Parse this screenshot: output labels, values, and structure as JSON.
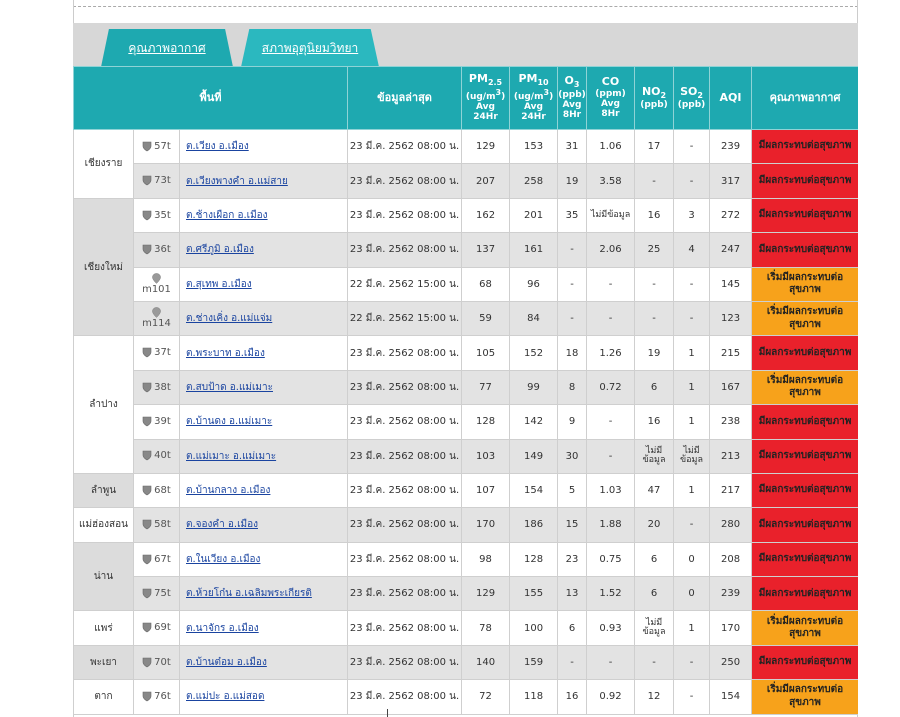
{
  "tabs": [
    {
      "label": "คุณภาพอากาศ",
      "active": true
    },
    {
      "label": "สภาพอุตุนิยมวิทยา",
      "active": false
    }
  ],
  "headers": {
    "area": "พื้นที่",
    "latest": "ข้อมูลล่าสุด",
    "pm25_main": "PM",
    "pm25_sub": "2.5",
    "pm25_unit": "(ug/m",
    "pm25_unit_sup": "3",
    "pm25_unit_end": ")",
    "pm25_avg": "Avg",
    "pm25_period": "24Hr",
    "pm10_main": "PM",
    "pm10_sub": "10",
    "pm10_unit": "(ug/m",
    "pm10_unit_sup": "3",
    "pm10_unit_end": ")",
    "pm10_avg": "Avg",
    "pm10_period": "24Hr",
    "o3_main": "O",
    "o3_sub": "3",
    "o3_unit": "(ppb)",
    "o3_avg": "Avg",
    "o3_period": "8Hr",
    "co_main": "CO",
    "co_unit": "(ppm)",
    "co_avg": "Avg",
    "co_period": "8Hr",
    "no2_main": "NO",
    "no2_sub": "2",
    "no2_unit": "(ppb)",
    "so2_main": "SO",
    "so2_sub": "2",
    "so2_unit": "(ppb)",
    "aqi": "AQI",
    "quality": "คุณภาพอากาศ"
  },
  "colors": {
    "header": "#1ea9b0",
    "red": "#e9212b",
    "orange": "#f7a21b",
    "link": "#1a44a0"
  },
  "status_text": {
    "red": "มีผลกระทบต่อสุขภาพ",
    "orange": "เริ่มมีผลกระทบต่อสุขภาพ"
  },
  "provinces": [
    {
      "name": "เชียงราย",
      "rowspan": 2,
      "shade": "white"
    },
    {
      "name": "เชียงใหม่",
      "rowspan": 4,
      "shade": "gray"
    },
    {
      "name": "ลำปาง",
      "rowspan": 4,
      "shade": "white"
    },
    {
      "name": "ลำพูน",
      "rowspan": 1,
      "shade": "gray"
    },
    {
      "name": "แม่ฮ่องสอน",
      "rowspan": 1,
      "shade": "white"
    },
    {
      "name": "น่าน",
      "rowspan": 2,
      "shade": "gray"
    },
    {
      "name": "แพร่",
      "rowspan": 1,
      "shade": "white"
    },
    {
      "name": "พะเยา",
      "rowspan": 1,
      "shade": "gray"
    },
    {
      "name": "ตาก",
      "rowspan": 1,
      "shade": "white"
    }
  ],
  "rows": [
    {
      "icon": "shield",
      "code": "57t",
      "site": "ต.เวียง อ.เมือง",
      "date": "23 มี.ค. 2562 08:00 น.",
      "pm25": "129",
      "pm10": "153",
      "o3": "31",
      "co": "1.06",
      "no2": "17",
      "so2": "-",
      "aqi": "239",
      "level": "red"
    },
    {
      "icon": "shield",
      "code": "73t",
      "site": "ต.เวียงพางคำ อ.แม่สาย",
      "date": "23 มี.ค. 2562 08:00 น.",
      "pm25": "207",
      "pm10": "258",
      "o3": "19",
      "co": "3.58",
      "no2": "-",
      "so2": "-",
      "aqi": "317",
      "level": "red"
    },
    {
      "icon": "shield",
      "code": "35t",
      "site": "ต.ช้างเผือก อ.เมือง",
      "date": "23 มี.ค. 2562 08:00 น.",
      "pm25": "162",
      "pm10": "201",
      "o3": "35",
      "co": "ไม่มีข้อมูล",
      "no2": "16",
      "so2": "3",
      "aqi": "272",
      "level": "red"
    },
    {
      "icon": "shield",
      "code": "36t",
      "site": "ต.ศรีภูมิ อ.เมือง",
      "date": "23 มี.ค. 2562 08:00 น.",
      "pm25": "137",
      "pm10": "161",
      "o3": "-",
      "co": "2.06",
      "no2": "25",
      "so2": "4",
      "aqi": "247",
      "level": "red"
    },
    {
      "icon": "pin",
      "code": "m101",
      "site": "ต.สุเทพ อ.เมือง",
      "date": "22 มี.ค. 2562 15:00 น.",
      "pm25": "68",
      "pm10": "96",
      "o3": "-",
      "co": "-",
      "no2": "-",
      "so2": "-",
      "aqi": "145",
      "level": "orange"
    },
    {
      "icon": "pin",
      "code": "m114",
      "site": "ต.ช่างเคิ่ง อ.แม่แจ่ม",
      "date": "22 มี.ค. 2562 15:00 น.",
      "pm25": "59",
      "pm10": "84",
      "o3": "-",
      "co": "-",
      "no2": "-",
      "so2": "-",
      "aqi": "123",
      "level": "orange"
    },
    {
      "icon": "shield",
      "code": "37t",
      "site": "ต.พระบาท อ.เมือง",
      "date": "23 มี.ค. 2562 08:00 น.",
      "pm25": "105",
      "pm10": "152",
      "o3": "18",
      "co": "1.26",
      "no2": "19",
      "so2": "1",
      "aqi": "215",
      "level": "red"
    },
    {
      "icon": "shield",
      "code": "38t",
      "site": "ต.สบป้าด อ.แม่เมาะ",
      "date": "23 มี.ค. 2562 08:00 น.",
      "pm25": "77",
      "pm10": "99",
      "o3": "8",
      "co": "0.72",
      "no2": "6",
      "so2": "1",
      "aqi": "167",
      "level": "orange"
    },
    {
      "icon": "shield",
      "code": "39t",
      "site": "ต.บ้านดง อ.แม่เมาะ",
      "date": "23 มี.ค. 2562 08:00 น.",
      "pm25": "128",
      "pm10": "142",
      "o3": "9",
      "co": "-",
      "no2": "16",
      "so2": "1",
      "aqi": "238",
      "level": "red"
    },
    {
      "icon": "shield",
      "code": "40t",
      "site": "ต.แม่เมาะ อ.แม่เมาะ",
      "date": "23 มี.ค. 2562 08:00 น.",
      "pm25": "103",
      "pm10": "149",
      "o3": "30",
      "co": "-",
      "no2": "ไม่มีข้อมูล",
      "so2": "ไม่มีข้อมูล",
      "aqi": "213",
      "level": "red"
    },
    {
      "icon": "shield",
      "code": "68t",
      "site": "ต.บ้านกลาง อ.เมือง",
      "date": "23 มี.ค. 2562 08:00 น.",
      "pm25": "107",
      "pm10": "154",
      "o3": "5",
      "co": "1.03",
      "no2": "47",
      "so2": "1",
      "aqi": "217",
      "level": "red"
    },
    {
      "icon": "shield",
      "code": "58t",
      "site": "ต.จองคำ อ.เมือง",
      "date": "23 มี.ค. 2562 08:00 น.",
      "pm25": "170",
      "pm10": "186",
      "o3": "15",
      "co": "1.88",
      "no2": "20",
      "so2": "-",
      "aqi": "280",
      "level": "red"
    },
    {
      "icon": "shield",
      "code": "67t",
      "site": "ต.ในเวียง อ.เมือง",
      "date": "23 มี.ค. 2562 08:00 น.",
      "pm25": "98",
      "pm10": "128",
      "o3": "23",
      "co": "0.75",
      "no2": "6",
      "so2": "0",
      "aqi": "208",
      "level": "red"
    },
    {
      "icon": "shield",
      "code": "75t",
      "site": "ต.ห้วยโก๋น อ.เฉลิมพระเกียรติ",
      "date": "23 มี.ค. 2562 08:00 น.",
      "pm25": "129",
      "pm10": "155",
      "o3": "13",
      "co": "1.52",
      "no2": "6",
      "so2": "0",
      "aqi": "239",
      "level": "red"
    },
    {
      "icon": "shield",
      "code": "69t",
      "site": "ต.นาจักร อ.เมือง",
      "date": "23 มี.ค. 2562 08:00 น.",
      "pm25": "78",
      "pm10": "100",
      "o3": "6",
      "co": "0.93",
      "no2": "ไม่มีข้อมูล",
      "so2": "1",
      "aqi": "170",
      "level": "orange"
    },
    {
      "icon": "shield",
      "code": "70t",
      "site": "ต.บ้านต๋อม อ.เมือง",
      "date": "23 มี.ค. 2562 08:00 น.",
      "pm25": "140",
      "pm10": "159",
      "o3": "-",
      "co": "-",
      "no2": "-",
      "so2": "-",
      "aqi": "250",
      "level": "red"
    },
    {
      "icon": "shield",
      "code": "76t",
      "site": "ต.แม่ปะ อ.แม่สอด",
      "date": "23 มี.ค. 2562 08:00 น.",
      "pm25": "72",
      "pm10": "118",
      "o3": "16",
      "co": "0.92",
      "no2": "12",
      "so2": "-",
      "aqi": "154",
      "level": "orange"
    }
  ]
}
